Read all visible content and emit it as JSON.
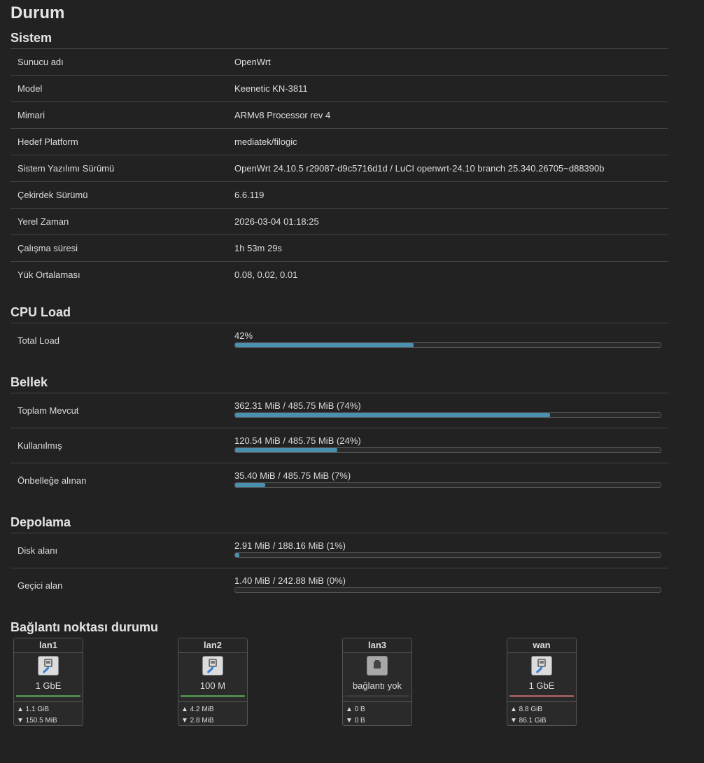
{
  "page_title": "Durum",
  "system": {
    "title": "Sistem",
    "rows": [
      {
        "key": "Sunucu adı",
        "value": "OpenWrt"
      },
      {
        "key": "Model",
        "value": "Keenetic KN-3811"
      },
      {
        "key": "Mimari",
        "value": "ARMv8 Processor rev 4"
      },
      {
        "key": "Hedef Platform",
        "value": "mediatek/filogic"
      },
      {
        "key": "Sistem Yazılımı Sürümü",
        "value": "OpenWrt 24.10.5 r29087-d9c5716d1d / LuCI openwrt-24.10 branch 25.340.26705~d88390b"
      },
      {
        "key": "Çekirdek Sürümü",
        "value": "6.6.119"
      },
      {
        "key": "Yerel Zaman",
        "value": "2026-03-04 01:18:25"
      },
      {
        "key": "Çalışma süresi",
        "value": "1h 53m 29s"
      },
      {
        "key": "Yük Ortalaması",
        "value": "0.08, 0.02, 0.01"
      }
    ]
  },
  "cpu": {
    "title": "CPU Load",
    "rows": [
      {
        "key": "Total Load",
        "label": "42%",
        "fraction": 0.42
      }
    ]
  },
  "memory": {
    "title": "Bellek",
    "rows": [
      {
        "key": "Toplam Mevcut",
        "label": "362.31 MiB / 485.75 MiB (74%)",
        "fraction": 0.74
      },
      {
        "key": "Kullanılmış",
        "label": "120.54 MiB / 485.75 MiB (24%)",
        "fraction": 0.24
      },
      {
        "key": "Önbelleğe alınan",
        "label": "35.40 MiB / 485.75 MiB (7%)",
        "fraction": 0.07
      }
    ]
  },
  "storage": {
    "title": "Depolama",
    "rows": [
      {
        "key": "Disk alanı",
        "label": "2.91 MiB / 188.16 MiB (1%)",
        "fraction": 0.01
      },
      {
        "key": "Geçici alan",
        "label": "1.40 MiB / 242.88 MiB (0%)",
        "fraction": 0.0
      }
    ]
  },
  "ports": {
    "title": "Bağlantı noktası durumu",
    "items": [
      {
        "name": "lan1",
        "icon": "ethernet-connected-icon",
        "speed": "1 GbE",
        "up": "▲ 1.1 GiB",
        "down": "▼ 150.5 MiB",
        "line_color": "#4e8a4e",
        "connected": true
      },
      {
        "name": "lan2",
        "icon": "ethernet-connected-icon",
        "speed": "100 M",
        "up": "▲ 4.2 MiB",
        "down": "▼ 2.8 MiB",
        "line_color": "#4e8a4e",
        "connected": true
      },
      {
        "name": "lan3",
        "icon": "ethernet-disconnected-icon",
        "speed": "bağlantı yok",
        "up": "▲ 0 B",
        "down": "▼ 0 B",
        "line_color": "#3a3a3a",
        "connected": false
      },
      {
        "name": "wan",
        "icon": "ethernet-connected-icon",
        "speed": "1 GbE",
        "up": "▲ 8.8 GiB",
        "down": "▼ 86.1 GiB",
        "line_color": "#9a5a5a",
        "connected": true
      }
    ]
  }
}
